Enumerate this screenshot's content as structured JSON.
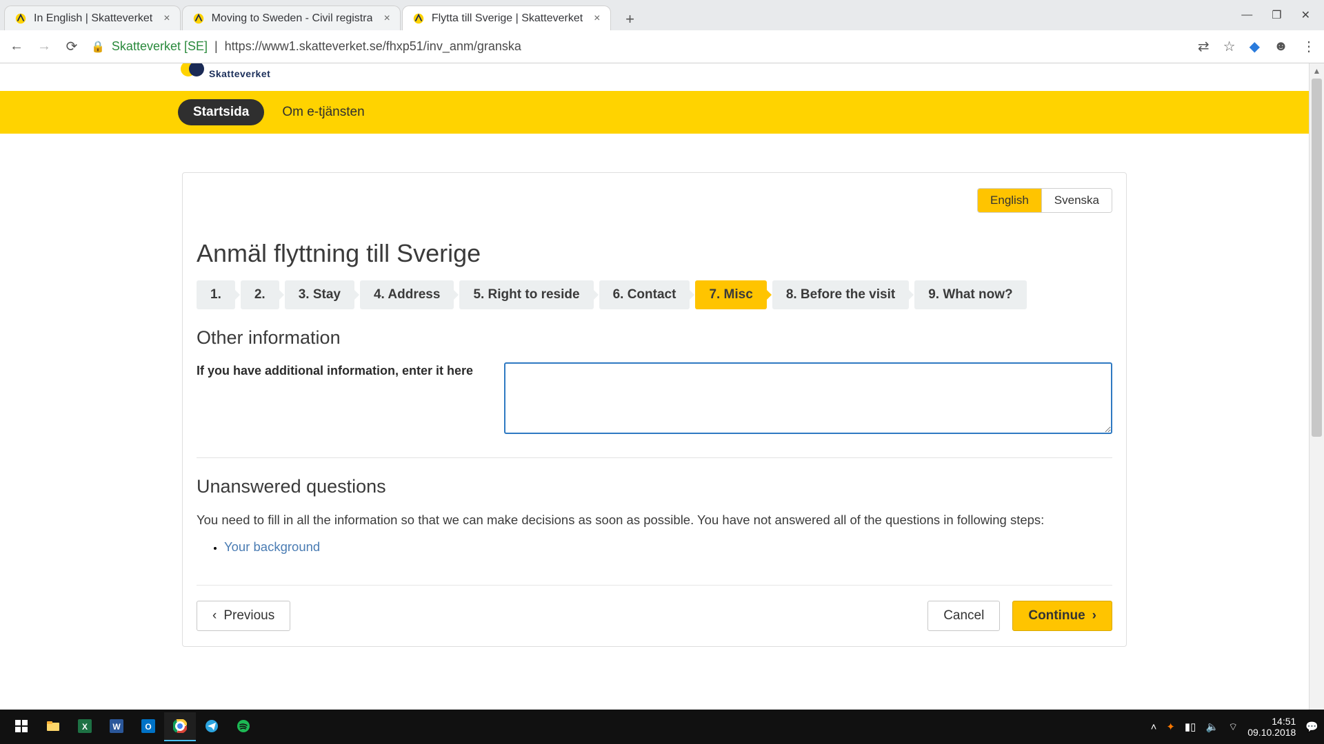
{
  "browser": {
    "tabs": [
      {
        "label": "In English | Skatteverket"
      },
      {
        "label": "Moving to Sweden - Civil registra"
      },
      {
        "label": "Flytta till Sverige | Skatteverket"
      }
    ],
    "active_tab": 2,
    "url_site": "Skatteverket [SE]",
    "url_path": "https://www1.skatteverket.se/fhxp51/inv_anm/granska"
  },
  "site": {
    "brand_sub": "Skatteverket",
    "cutoff_title": "Flytta till Sverige",
    "nav_home": "Startsida",
    "nav_about": "Om e-tjänsten"
  },
  "lang": {
    "english": "English",
    "svenska": "Svenska"
  },
  "page": {
    "title": "Anmäl flyttning till Sverige",
    "section_other": "Other information",
    "other_label": "If you have additional information, enter it here",
    "section_unanswered": "Unanswered questions",
    "unanswered_text": "You need to fill in all the information so that we can make decisions as soon as possible. You have not answered all of the questions in following steps:",
    "unanswered_link": "Your background"
  },
  "steps": [
    {
      "label": "1."
    },
    {
      "label": "2."
    },
    {
      "label": "3.  Stay"
    },
    {
      "label": "4.  Address"
    },
    {
      "label": "5.  Right to reside"
    },
    {
      "label": "6.  Contact"
    },
    {
      "label": "7.  Misc"
    },
    {
      "label": "8.  Before the visit"
    },
    {
      "label": "9.  What now?"
    }
  ],
  "steps_active": 6,
  "actions": {
    "previous": "Previous",
    "cancel": "Cancel",
    "continue": "Continue"
  },
  "taskbar": {
    "time": "14:51",
    "date": "09.10.2018"
  }
}
